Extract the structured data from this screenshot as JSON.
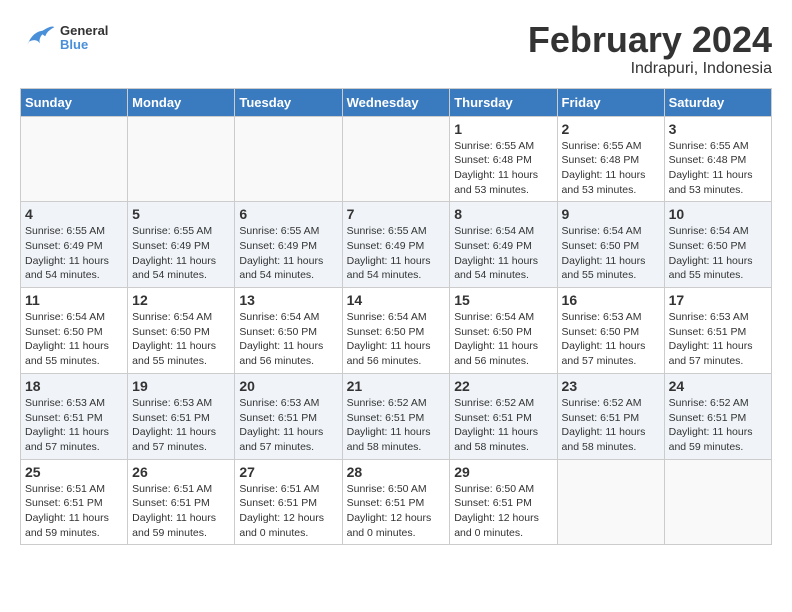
{
  "logo": {
    "text_general": "General",
    "text_blue": "Blue"
  },
  "title": "February 2024",
  "subtitle": "Indrapuri, Indonesia",
  "weekdays": [
    "Sunday",
    "Monday",
    "Tuesday",
    "Wednesday",
    "Thursday",
    "Friday",
    "Saturday"
  ],
  "weeks": [
    [
      {
        "day": "",
        "info": ""
      },
      {
        "day": "",
        "info": ""
      },
      {
        "day": "",
        "info": ""
      },
      {
        "day": "",
        "info": ""
      },
      {
        "day": "1",
        "info": "Sunrise: 6:55 AM\nSunset: 6:48 PM\nDaylight: 11 hours\nand 53 minutes."
      },
      {
        "day": "2",
        "info": "Sunrise: 6:55 AM\nSunset: 6:48 PM\nDaylight: 11 hours\nand 53 minutes."
      },
      {
        "day": "3",
        "info": "Sunrise: 6:55 AM\nSunset: 6:48 PM\nDaylight: 11 hours\nand 53 minutes."
      }
    ],
    [
      {
        "day": "4",
        "info": "Sunrise: 6:55 AM\nSunset: 6:49 PM\nDaylight: 11 hours\nand 54 minutes."
      },
      {
        "day": "5",
        "info": "Sunrise: 6:55 AM\nSunset: 6:49 PM\nDaylight: 11 hours\nand 54 minutes."
      },
      {
        "day": "6",
        "info": "Sunrise: 6:55 AM\nSunset: 6:49 PM\nDaylight: 11 hours\nand 54 minutes."
      },
      {
        "day": "7",
        "info": "Sunrise: 6:55 AM\nSunset: 6:49 PM\nDaylight: 11 hours\nand 54 minutes."
      },
      {
        "day": "8",
        "info": "Sunrise: 6:54 AM\nSunset: 6:49 PM\nDaylight: 11 hours\nand 54 minutes."
      },
      {
        "day": "9",
        "info": "Sunrise: 6:54 AM\nSunset: 6:50 PM\nDaylight: 11 hours\nand 55 minutes."
      },
      {
        "day": "10",
        "info": "Sunrise: 6:54 AM\nSunset: 6:50 PM\nDaylight: 11 hours\nand 55 minutes."
      }
    ],
    [
      {
        "day": "11",
        "info": "Sunrise: 6:54 AM\nSunset: 6:50 PM\nDaylight: 11 hours\nand 55 minutes."
      },
      {
        "day": "12",
        "info": "Sunrise: 6:54 AM\nSunset: 6:50 PM\nDaylight: 11 hours\nand 55 minutes."
      },
      {
        "day": "13",
        "info": "Sunrise: 6:54 AM\nSunset: 6:50 PM\nDaylight: 11 hours\nand 56 minutes."
      },
      {
        "day": "14",
        "info": "Sunrise: 6:54 AM\nSunset: 6:50 PM\nDaylight: 11 hours\nand 56 minutes."
      },
      {
        "day": "15",
        "info": "Sunrise: 6:54 AM\nSunset: 6:50 PM\nDaylight: 11 hours\nand 56 minutes."
      },
      {
        "day": "16",
        "info": "Sunrise: 6:53 AM\nSunset: 6:50 PM\nDaylight: 11 hours\nand 57 minutes."
      },
      {
        "day": "17",
        "info": "Sunrise: 6:53 AM\nSunset: 6:51 PM\nDaylight: 11 hours\nand 57 minutes."
      }
    ],
    [
      {
        "day": "18",
        "info": "Sunrise: 6:53 AM\nSunset: 6:51 PM\nDaylight: 11 hours\nand 57 minutes."
      },
      {
        "day": "19",
        "info": "Sunrise: 6:53 AM\nSunset: 6:51 PM\nDaylight: 11 hours\nand 57 minutes."
      },
      {
        "day": "20",
        "info": "Sunrise: 6:53 AM\nSunset: 6:51 PM\nDaylight: 11 hours\nand 57 minutes."
      },
      {
        "day": "21",
        "info": "Sunrise: 6:52 AM\nSunset: 6:51 PM\nDaylight: 11 hours\nand 58 minutes."
      },
      {
        "day": "22",
        "info": "Sunrise: 6:52 AM\nSunset: 6:51 PM\nDaylight: 11 hours\nand 58 minutes."
      },
      {
        "day": "23",
        "info": "Sunrise: 6:52 AM\nSunset: 6:51 PM\nDaylight: 11 hours\nand 58 minutes."
      },
      {
        "day": "24",
        "info": "Sunrise: 6:52 AM\nSunset: 6:51 PM\nDaylight: 11 hours\nand 59 minutes."
      }
    ],
    [
      {
        "day": "25",
        "info": "Sunrise: 6:51 AM\nSunset: 6:51 PM\nDaylight: 11 hours\nand 59 minutes."
      },
      {
        "day": "26",
        "info": "Sunrise: 6:51 AM\nSunset: 6:51 PM\nDaylight: 11 hours\nand 59 minutes."
      },
      {
        "day": "27",
        "info": "Sunrise: 6:51 AM\nSunset: 6:51 PM\nDaylight: 12 hours\nand 0 minutes."
      },
      {
        "day": "28",
        "info": "Sunrise: 6:50 AM\nSunset: 6:51 PM\nDaylight: 12 hours\nand 0 minutes."
      },
      {
        "day": "29",
        "info": "Sunrise: 6:50 AM\nSunset: 6:51 PM\nDaylight: 12 hours\nand 0 minutes."
      },
      {
        "day": "",
        "info": ""
      },
      {
        "day": "",
        "info": ""
      }
    ]
  ]
}
